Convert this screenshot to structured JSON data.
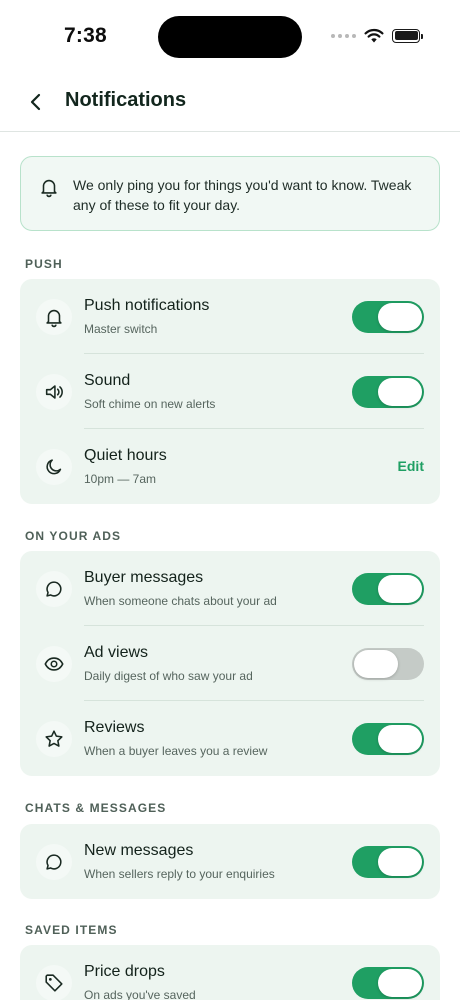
{
  "status_bar": {
    "time": "7:38"
  },
  "header": {
    "title": "Notifications"
  },
  "banner": {
    "text": "We only ping you for things you'd want to know. Tweak any of these to fit your day."
  },
  "colors": {
    "accent": "#1f9f63",
    "card_bg": "#edf5f0",
    "banner_bg": "#f1f8f4",
    "toggle_off": "#c5cbc7"
  },
  "sections": [
    {
      "label": "PUSH",
      "rows": [
        {
          "icon": "bell-icon",
          "title": "Push notifications",
          "subtitle": "Master switch",
          "control": "toggle",
          "on": true
        },
        {
          "icon": "speaker-icon",
          "title": "Sound",
          "subtitle": "Soft chime on new alerts",
          "control": "toggle",
          "on": true
        },
        {
          "icon": "moon-icon",
          "title": "Quiet hours",
          "subtitle": "10pm — 7am",
          "control": "edit",
          "action_label": "Edit"
        }
      ]
    },
    {
      "label": "ON YOUR ADS",
      "rows": [
        {
          "icon": "chat-bubble-icon",
          "title": "Buyer messages",
          "subtitle": "When someone chats about your ad",
          "control": "toggle",
          "on": true
        },
        {
          "icon": "eye-icon",
          "title": "Ad views",
          "subtitle": "Daily digest of who saw your ad",
          "control": "toggle",
          "on": false
        },
        {
          "icon": "star-icon",
          "title": "Reviews",
          "subtitle": "When a buyer leaves you a review",
          "control": "toggle",
          "on": true
        }
      ]
    },
    {
      "label": "CHATS & MESSAGES",
      "rows": [
        {
          "icon": "chat-bubble-icon",
          "title": "New messages",
          "subtitle": "When sellers reply to your enquiries",
          "control": "toggle",
          "on": true
        }
      ]
    },
    {
      "label": "SAVED ITEMS",
      "rows": [
        {
          "icon": "tag-icon",
          "title": "Price drops",
          "subtitle": "On ads you've saved",
          "control": "toggle",
          "on": true
        }
      ]
    }
  ]
}
